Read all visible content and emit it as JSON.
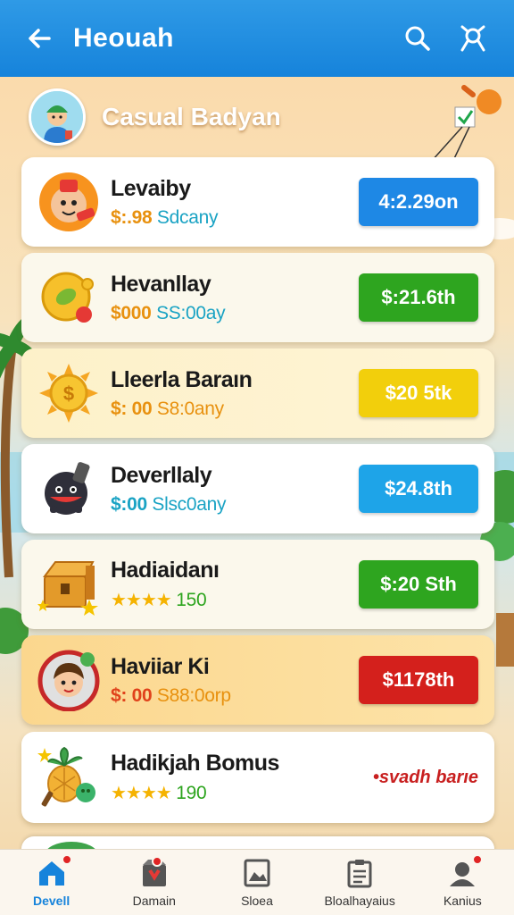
{
  "appbar": {
    "title": "Heouah",
    "back_icon": "arrow-left-icon",
    "search_icon": "search-icon",
    "profile_icon": "person-icon"
  },
  "header": {
    "title": "Casual Badyan",
    "avatar_icon": "user-avatar"
  },
  "items": [
    {
      "name": "Levaiby",
      "sub_highlight": "$:.98",
      "sub_rest": "Sdcany",
      "price": "4:2.29on",
      "price_color": "#1e88e5",
      "icon": "mascot-icon"
    },
    {
      "name": "Hevanllay",
      "sub_highlight": "$000",
      "sub_rest": "SS:00ay",
      "price": "$:21.6th",
      "price_color": "#2ea51f",
      "icon": "coins-icon"
    },
    {
      "name": "Lleerla Baraın",
      "sub_highlight": "$: 00",
      "sub_rest": "S8:0any",
      "price": "$20 5tk",
      "price_color": "#f2cf0c",
      "icon": "sun-coin-icon"
    },
    {
      "name": "Deverllaly",
      "sub_highlight": "$:00",
      "sub_rest": "Slsc0any",
      "price": "$24.8th",
      "price_color": "#1ea4e8",
      "icon": "bomb-icon"
    },
    {
      "name": "Hadiaidanı",
      "stars": "★★★★",
      "rating": "150",
      "price": "$:20 Sth",
      "price_color": "#2ea51f",
      "icon": "treasure-chest-icon"
    },
    {
      "name": "Haviiar Ki",
      "sub_highlight": "$: 00",
      "sub_rest": "S88:0orp",
      "price": "$1178th",
      "price_color": "#d4201c",
      "icon": "character-badge-icon"
    },
    {
      "name": "Hadikjah Bomus",
      "stars": "★★★★",
      "rating": "190",
      "bonus_text": "•svadh barıe",
      "icon": "pineapple-bonus-icon"
    }
  ],
  "nav": [
    {
      "label": "Devell",
      "icon": "home-icon",
      "active": true
    },
    {
      "label": "Damain",
      "icon": "store-icon",
      "active": false
    },
    {
      "label": "Sloea",
      "icon": "gallery-icon",
      "active": false
    },
    {
      "label": "Bloalhayaius",
      "icon": "clipboard-icon",
      "active": false
    },
    {
      "label": "Kanius",
      "icon": "profile-icon",
      "active": false
    }
  ],
  "colors": {
    "primary": "#1683db",
    "green": "#2ea51f",
    "yellow": "#f2cf0c",
    "red": "#d4201c",
    "orange_text": "#e8910f",
    "teal_text": "#1aa3c4"
  }
}
